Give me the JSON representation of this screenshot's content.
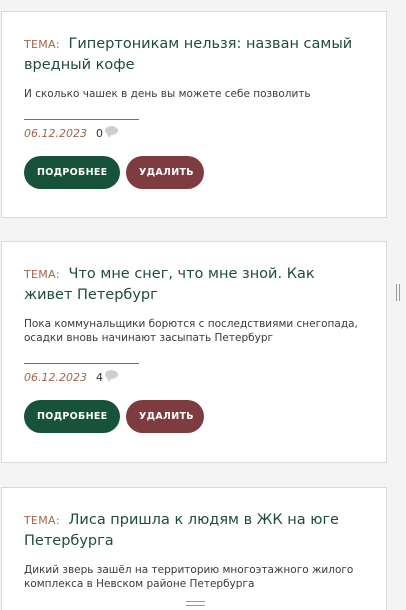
{
  "theme_prefix": "ТЕМА:",
  "colors": {
    "title": "#1e4d38",
    "tema": "#a4644a",
    "more_button": "#16533a",
    "delete_button": "#7e3b40"
  },
  "cards": [
    {
      "title": "Гипертоникам нельзя: назван самый вредный кофе",
      "description": "И сколько чашек в день вы можете себе позволить",
      "date": "06.12.2023",
      "comments": "0",
      "more_label": "ПОДРОБНЕЕ",
      "delete_label": "УДАЛИТЬ"
    },
    {
      "title": "Что мне снег, что мне зной. Как живет Петербург",
      "description": "Пока коммунальщики борются с последствиями снегопада, осадки вновь начинают засыпать Петербург",
      "date": "06.12.2023",
      "comments": "4",
      "more_label": "ПОДРОБНЕЕ",
      "delete_label": "УДАЛИТЬ"
    },
    {
      "title": "Лиса пришла к людям в ЖК на юге Петербурга",
      "description": "Дикий зверь зашёл на территорию многоэтажного жилого комплекса в Невском районе Петербурга"
    }
  ]
}
